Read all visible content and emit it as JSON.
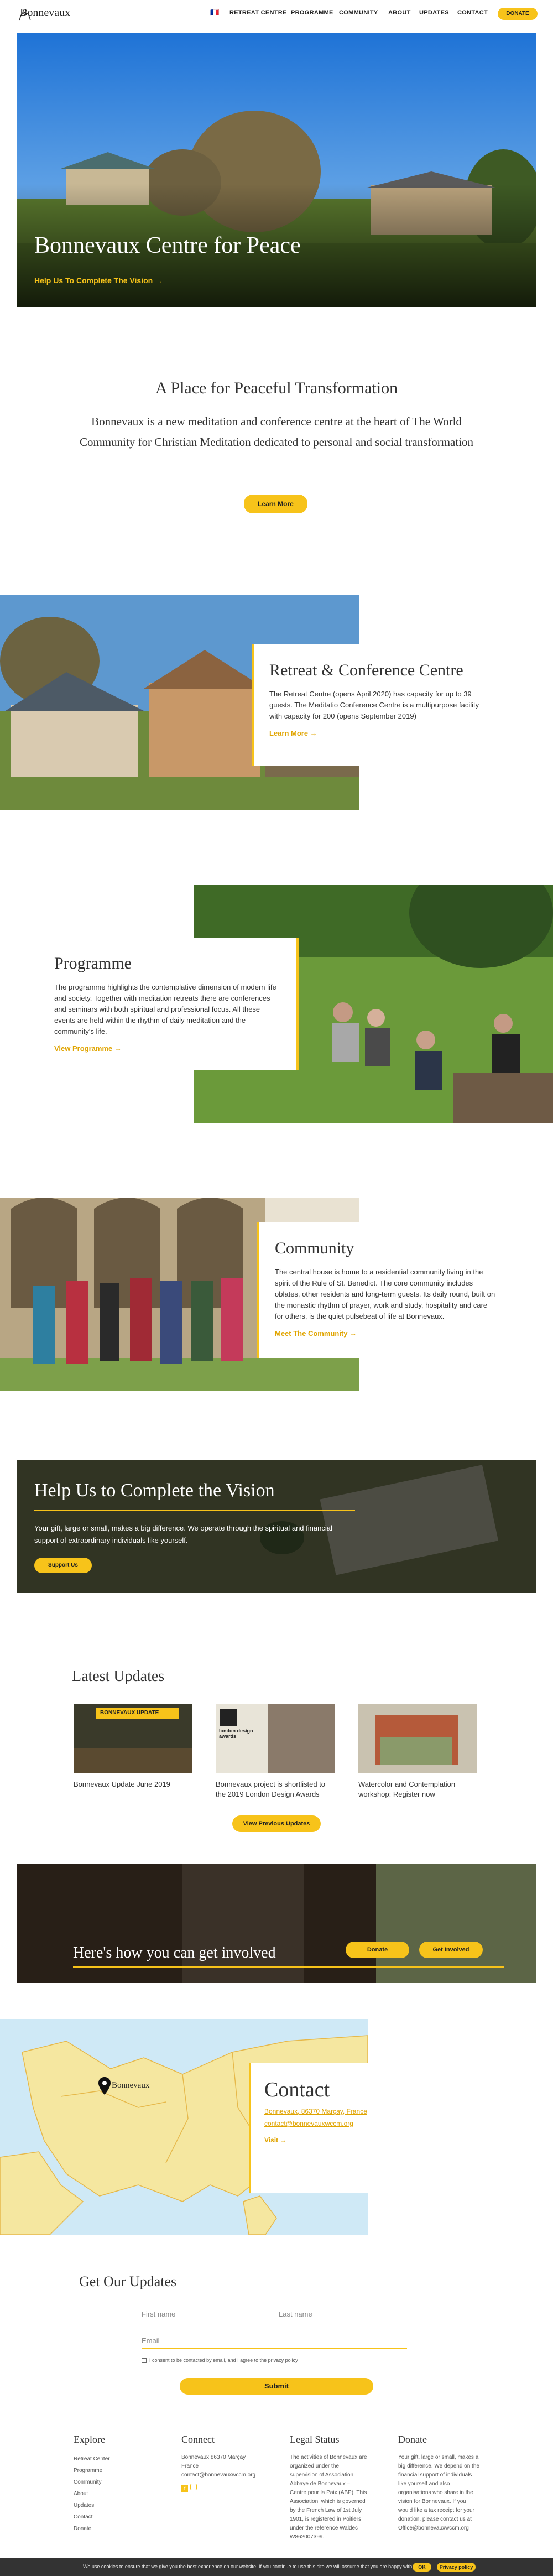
{
  "site": {
    "logo": "Bonnevaux"
  },
  "nav": {
    "flag": "🇫🇷",
    "items": [
      "RETREAT CENTRE",
      "PROGRAMME",
      "COMMUNITY",
      "ABOUT",
      "UPDATES",
      "CONTACT"
    ],
    "donate": "DONATE"
  },
  "hero": {
    "title": "Bonnevaux Centre for Peace",
    "link": "Help Us To Complete The Vision →"
  },
  "intro": {
    "title": "A Place for Peaceful Transformation",
    "text": "Bonnevaux is a new meditation and conference centre at the heart of The World Community for Christian Meditation dedicated to personal and social transformation",
    "button": "Learn More"
  },
  "retreat": {
    "title": "Retreat & Conference Centre",
    "text": "The Retreat Centre (opens April 2020) has capacity for up to 39 guests. The Meditatio Conference Centre is a multipurpose facility with capacity for 200 (opens September 2019)",
    "link": "Learn More →"
  },
  "programme": {
    "title": "Programme",
    "text": "The programme highlights the contemplative dimension of modern life and society. Together with meditation retreats there are conferences and seminars with both spiritual and professional focus. All these events are held within the rhythm of daily meditation and the community's life.",
    "link": "View Programme →"
  },
  "community": {
    "title": "Community",
    "text": "The central house is home to a residential community living in the spirit of the Rule of St. Benedict. The core community includes oblates, other residents and long-term guests. Its daily round, built on the monastic rhythm of prayer, work and study, hospitality and care for others, is the quiet pulsebeat of life at Bonnevaux.",
    "link": "Meet The Community →"
  },
  "help": {
    "title": "Help Us to Complete the Vision",
    "text": "Your gift, large or small, makes a big difference. We operate through the spiritual and financial support of extraordinary individuals like yourself.",
    "button": "Support Us"
  },
  "updates": {
    "title": "Latest Updates",
    "items": [
      {
        "caption": "Bonnevaux Update June 2019",
        "badge": "BONNEVAUX UPDATE"
      },
      {
        "caption": "Bonnevaux project is shortlisted to the 2019 London Design Awards",
        "badge": "london design awards"
      },
      {
        "caption": "Watercolor and Contemplation workshop: Register now",
        "badge": ""
      }
    ],
    "button": "View Previous Updates"
  },
  "involved": {
    "title": "Here's how you can get involved",
    "donate": "Donate",
    "get_involved": "Get Involved"
  },
  "map": {
    "pin_label": "Bonnevaux"
  },
  "contact": {
    "title": "Contact",
    "address": "Bonnevaux, 86370 Marçay, France",
    "email": "contact@bonnevauxwccm.org",
    "link": "Visit →"
  },
  "form": {
    "title": "Get Our Updates",
    "first_name": "First name",
    "last_name": "Last name",
    "email": "Email",
    "consent": "I consent to be contacted by email, and I agree to the privacy policy",
    "submit": "Submit"
  },
  "footer": {
    "explore": {
      "title": "Explore",
      "items": [
        "Retreat Center",
        "Programme",
        "Community",
        "About",
        "Updates",
        "Contact",
        "Donate"
      ]
    },
    "connect": {
      "title": "Connect",
      "address": "Bonnevaux 86370 Marçay France",
      "email": "contact@bonnevauxwccm.org"
    },
    "legal": {
      "title": "Legal Status",
      "text": "The activities of Bonnevaux are organized under the supervision of Association Abbaye de Bonnevaux – Centre pour la Paix (ABP). This Association, which is governed by the French Law of 1st July 1901, is registered in Poitiers under the reference Waldec W862007399."
    },
    "donate": {
      "title": "Donate",
      "text": "Your gift, large or small, makes a big difference. We depend on the financial support of individuals like yourself and also organisations who share in the vision for Bonnevaux. If you would like a tax receipt for your donation, please contact us at Office@bonnevauxwccm.org"
    }
  },
  "cookie": {
    "text": "We use cookies to ensure that we give you the best experience on our website. If you continue to use this site we will assume that you are happy with it.",
    "ok": "OK",
    "privacy": "Privacy policy"
  },
  "colors": {
    "accent": "#f7c31a",
    "text": "#333333"
  }
}
